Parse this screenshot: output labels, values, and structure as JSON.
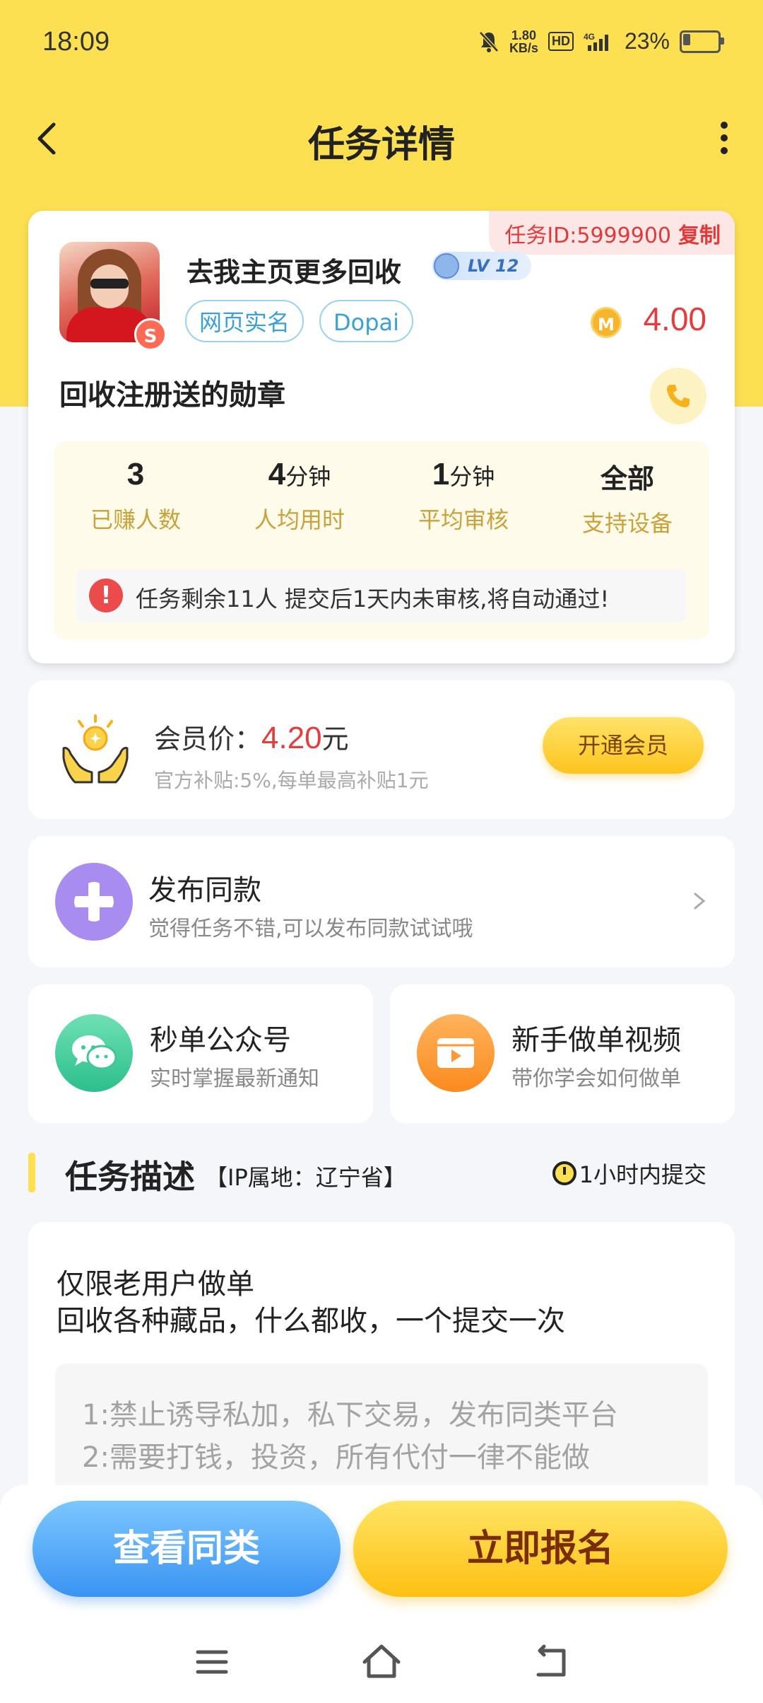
{
  "status": {
    "time": "18:09",
    "net_speed_top": "1.80",
    "net_speed_bottom": "KB/s",
    "hd": "HD",
    "network": "4G",
    "battery": "23%",
    "battery_level": 0.23
  },
  "nav": {
    "title": "任务详情"
  },
  "task": {
    "id_label": "任务ID:5999900",
    "copy": "复制",
    "user_name": "去我主页更多回收",
    "level": "LV 12",
    "tags": [
      "网页实名",
      "Dopai"
    ],
    "coin": "M",
    "price": "4.00",
    "title": "回收注册送的勋章",
    "stats": [
      {
        "value": "3",
        "unit": "",
        "label": "已赚人数"
      },
      {
        "value": "4",
        "unit": "分钟",
        "label": "人均用时"
      },
      {
        "value": "1",
        "unit": "分钟",
        "label": "平均审核"
      },
      {
        "value": "全部",
        "unit": "",
        "label": "支持设备"
      }
    ],
    "notice_icon": "!",
    "notice": "任务剩余11人  提交后1天内未审核,将自动通过!"
  },
  "vip": {
    "label": "会员价：",
    "price": "4.20",
    "unit": "元",
    "sub": "官方补贴:5%,每单最高补贴1元",
    "button": "开通会员"
  },
  "publish": {
    "title": "发布同款",
    "sub": "觉得任务不错,可以发布同款试试哦"
  },
  "promo": [
    {
      "title": "秒单公众号",
      "sub": "实时掌握最新通知"
    },
    {
      "title": "新手做单视频",
      "sub": "带你学会如何做单"
    }
  ],
  "desc": {
    "title": "任务描述",
    "ip": "【IP属地：辽宁省】",
    "deadline": "1小时内提交",
    "lines": [
      "仅限老用户做单",
      "回收各种藏品，什么都收，一个提交一次"
    ],
    "rules": [
      "1:禁止诱导私加，私下交易，发布同类平台",
      "2:需要打钱，投资，所有代付一律不能做"
    ]
  },
  "bottom": {
    "btn_same": "查看同类",
    "btn_join": "立即报名"
  },
  "colors": {
    "brand_yellow": "#fde052",
    "price_red": "#e53d3d",
    "stat_label": "#caa23b",
    "blue": "#3a94f2"
  }
}
